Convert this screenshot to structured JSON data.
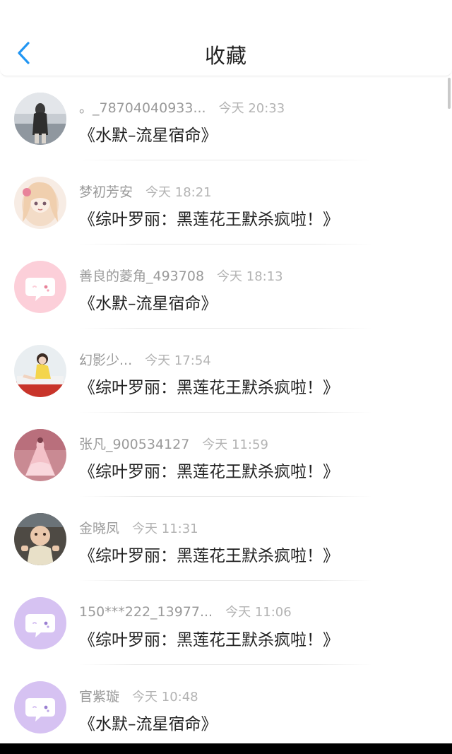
{
  "header": {
    "title": "收藏",
    "back_icon": "chevron-left-icon",
    "accent_color": "#2196f3"
  },
  "favorites": [
    {
      "username": "。_78704040933...",
      "time": "今天 20:33",
      "book": "《水默–流星宿命》",
      "avatar": "photo-girl-seaside"
    },
    {
      "username": "梦初芳安",
      "time": "今天 18:21",
      "book": "《综叶罗丽：黑莲花王默杀疯啦！》",
      "avatar": "anime-girl"
    },
    {
      "username": "善良的菱角_493708",
      "time": "今天 18:13",
      "book": "《水默–流星宿命》",
      "avatar": "default-chat-bubble-pink"
    },
    {
      "username": "幻影少...",
      "time": "今天 17:54",
      "book": "《综叶罗丽：黑莲花王默杀疯啦！》",
      "avatar": "photo-girl-yellow-dress"
    },
    {
      "username": "张凡_900534127",
      "time": "今天 11:59",
      "book": "《综叶罗丽：黑莲花王默杀疯啦！》",
      "avatar": "pink-dress-illustration"
    },
    {
      "username": "金晓凤",
      "time": "今天 11:31",
      "book": "《综叶罗丽：黑莲花王默杀疯啦！》",
      "avatar": "photo-baby"
    },
    {
      "username": "150***222_13977...",
      "time": "今天 11:06",
      "book": "《综叶罗丽：黑莲花王默杀疯啦！》",
      "avatar": "default-chat-bubble-purple"
    },
    {
      "username": "官紫璇",
      "time": "今天 10:48",
      "book": "《水默–流星宿命》",
      "avatar": "default-chat-bubble-purple"
    }
  ],
  "colors": {
    "pink_avatar_bg": "#fccfd9",
    "purple_avatar_bg": "#d6c2f2",
    "username": "#9a9a9a",
    "timestamp": "#b3b3b3",
    "title_text": "#222222"
  }
}
